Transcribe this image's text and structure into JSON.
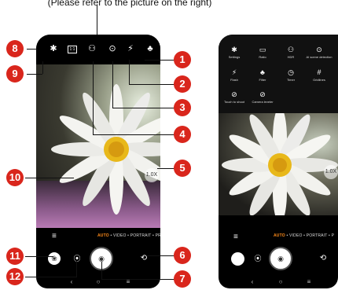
{
  "caption": "(Please refer to the picture on the right)",
  "callouts": [
    "1",
    "2",
    "3",
    "4",
    "5",
    "6",
    "7",
    "8",
    "9",
    "10",
    "11",
    "12"
  ],
  "phone1": {
    "top_icons": [
      "settings-icon",
      "ratio-icon",
      "hdr-icon",
      "ai-scene-icon",
      "flash-auto-icon",
      "filter-icon"
    ],
    "lens_label": "1.0X",
    "modes": [
      "AUTO",
      "VIDEO",
      "PORTRAIT",
      "PR"
    ],
    "active_mode": "AUTO"
  },
  "phone2": {
    "settings_items": [
      {
        "icon": "settings-icon",
        "label": "Settings"
      },
      {
        "icon": "ratio-icon",
        "label": "Ratio"
      },
      {
        "icon": "hdr-icon",
        "label": "HDR"
      },
      {
        "icon": "ai-scene-icon",
        "label": "AI scene detection"
      },
      {
        "icon": "flash-icon",
        "label": "Flash"
      },
      {
        "icon": "filter-icon",
        "label": "Filter"
      },
      {
        "icon": "timer-icon",
        "label": "Timer"
      },
      {
        "icon": "gridlines-icon",
        "label": "Gridlines"
      },
      {
        "icon": "touch-shoot-icon",
        "label": "Touch to shoot"
      },
      {
        "icon": "camera-leveler-icon",
        "label": "Camera leveler"
      }
    ],
    "lens_label": "1.0X",
    "modes": [
      "AUTO",
      "VIDEO",
      "PORTRAIT",
      "P"
    ],
    "active_mode": "AUTO"
  }
}
